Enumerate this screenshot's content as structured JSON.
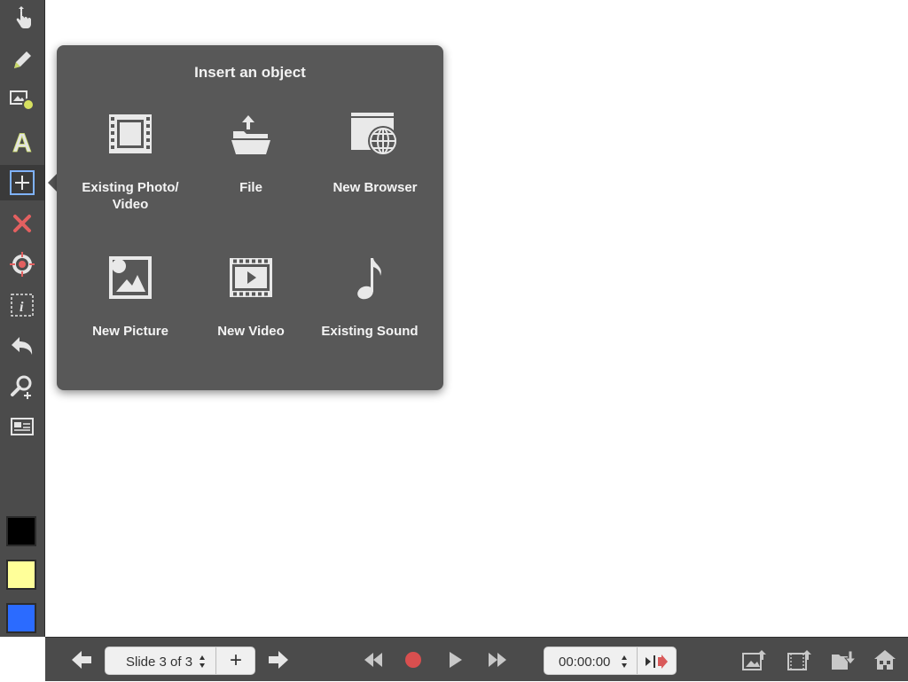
{
  "sidebar": {
    "tools": [
      {
        "name": "pointer-tool",
        "icon": "hand-pointer-icon"
      },
      {
        "name": "pen-tool",
        "icon": "pencil-icon"
      },
      {
        "name": "shapes-tool",
        "icon": "shapes-icon"
      },
      {
        "name": "text-tool",
        "icon": "text-a-icon"
      },
      {
        "name": "insert-object-tool",
        "icon": "plus-box-icon",
        "selected": true
      },
      {
        "name": "delete-tool",
        "icon": "x-icon"
      },
      {
        "name": "laser-tool",
        "icon": "target-icon"
      },
      {
        "name": "info-tool",
        "icon": "info-box-icon"
      },
      {
        "name": "undo-tool",
        "icon": "undo-icon"
      },
      {
        "name": "zoom-tool",
        "icon": "zoom-in-icon"
      },
      {
        "name": "background-tool",
        "icon": "slide-image-icon"
      }
    ],
    "swatches": [
      "#000000",
      "#ffff99",
      "#2b6bff"
    ]
  },
  "popover": {
    "title": "Insert an object",
    "items": [
      {
        "label": "Existing Photo/\nVideo",
        "icon": "film-strip-icon"
      },
      {
        "label": "File",
        "icon": "folder-upload-icon"
      },
      {
        "label": "New Browser",
        "icon": "browser-globe-icon"
      },
      {
        "label": "New Picture",
        "icon": "picture-icon"
      },
      {
        "label": "New Video",
        "icon": "video-play-icon"
      },
      {
        "label": "Existing Sound",
        "icon": "music-note-icon"
      }
    ]
  },
  "bottombar": {
    "slide_label": "Slide 3 of 3",
    "add_slide": "+",
    "time": "00:00:00",
    "record_color": "#d94f4f"
  }
}
